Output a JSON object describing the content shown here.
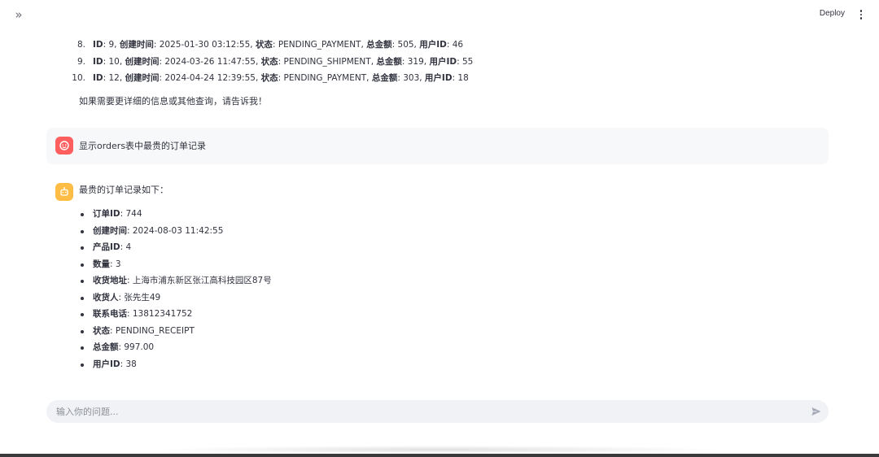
{
  "header": {
    "expand_icon": "double-chevron-right-icon",
    "deploy_label": "Deploy",
    "menu_icon": "vertical-ellipsis-icon"
  },
  "previous_answer": {
    "items": [
      {
        "num": "8.",
        "k1": "ID",
        "v1": ": 9, ",
        "k2": "创建时间",
        "v2": ": 2025-01-30 03:12:55, ",
        "k3": "状态",
        "v3": ": PENDING_PAYMENT, ",
        "k4": "总金额",
        "v4": ": 505, ",
        "k5": "用户ID",
        "v5": ": 46"
      },
      {
        "num": "9.",
        "k1": "ID",
        "v1": ": 10, ",
        "k2": "创建时间",
        "v2": ": 2024-03-26 11:47:55, ",
        "k3": "状态",
        "v3": ": PENDING_SHIPMENT, ",
        "k4": "总金额",
        "v4": ": 319, ",
        "k5": "用户ID",
        "v5": ": 55"
      },
      {
        "num": "10.",
        "k1": "ID",
        "v1": ": 12, ",
        "k2": "创建时间",
        "v2": ": 2024-04-24 12:39:55, ",
        "k3": "状态",
        "v3": ": PENDING_PAYMENT, ",
        "k4": "总金额",
        "v4": ": 303, ",
        "k5": "用户ID",
        "v5": ": 18"
      }
    ],
    "closing": "如果需要更详细的信息或其他查询，请告诉我！"
  },
  "user_message": {
    "avatar_icon": "user-face-icon",
    "text": "显示orders表中最贵的订单记录"
  },
  "assistant_message": {
    "avatar_icon": "robot-icon",
    "intro": "最贵的订单记录如下：",
    "fields": [
      {
        "key": "订单ID",
        "value": ": 744"
      },
      {
        "key": "创建时间",
        "value": ": 2024-08-03 11:42:55"
      },
      {
        "key": "产品ID",
        "value": ": 4"
      },
      {
        "key": "数量",
        "value": ": 3"
      },
      {
        "key": "收货地址",
        "value": ": 上海市浦东新区张江高科技园区87号"
      },
      {
        "key": "收货人",
        "value": ": 张先生49"
      },
      {
        "key": "联系电话",
        "value": ": 13812341752"
      },
      {
        "key": "状态",
        "value": ": PENDING_RECEIPT"
      },
      {
        "key": "总金额",
        "value": ": 997.00"
      },
      {
        "key": "用户ID",
        "value": ": 38"
      }
    ]
  },
  "chat_input": {
    "placeholder": "输入你的问题...",
    "send_icon": "send-icon"
  },
  "colors": {
    "user_avatar": "#ff5e5e",
    "bot_avatar": "#ffbd45",
    "text": "#31333f",
    "input_bg": "#f0f2f6"
  }
}
